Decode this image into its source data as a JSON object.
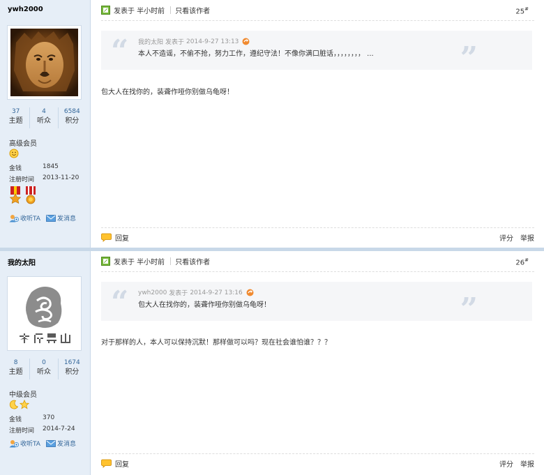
{
  "posts": [
    {
      "author": "ywh2000",
      "stats": [
        {
          "value": "37",
          "label": "主题"
        },
        {
          "value": "4",
          "label": "听众"
        },
        {
          "value": "6584",
          "label": "积分"
        }
      ],
      "rank": "高级会员",
      "info": [
        {
          "label": "金钱",
          "value": "1845"
        },
        {
          "label": "注册时间",
          "value": "2013-11-20"
        }
      ],
      "links": {
        "follow": "收听TA",
        "message": "发消息"
      },
      "header": {
        "posted": "发表于 半小时前",
        "only_author": "只看该作者",
        "floor": "25",
        "floor_mark": "#"
      },
      "quote": {
        "author": "我的太阳",
        "posted_label": "发表于",
        "time": "2014-9-27 13:13",
        "text": "本人不造谣，不偷不抢，努力工作，遵纪守法！不像你满口脏话，，，，，，，，  ..."
      },
      "content": "包大人在找你的，装聋作哑你别做乌龟呀！",
      "footer": {
        "reply": "回复",
        "rate": "评分",
        "report": "举报"
      }
    },
    {
      "author": "我的太阳",
      "avatar_text": "乐居昆山",
      "stats": [
        {
          "value": "8",
          "label": "主题"
        },
        {
          "value": "0",
          "label": "听众"
        },
        {
          "value": "1674",
          "label": "积分"
        }
      ],
      "rank": "中级会员",
      "info": [
        {
          "label": "金钱",
          "value": "370"
        },
        {
          "label": "注册时间",
          "value": "2014-7-24"
        }
      ],
      "links": {
        "follow": "收听TA",
        "message": "发消息"
      },
      "header": {
        "posted": "发表于 半小时前",
        "only_author": "只看该作者",
        "floor": "26",
        "floor_mark": "#"
      },
      "quote": {
        "author": "ywh2000",
        "posted_label": "发表于",
        "time": "2014-9-27 13:16",
        "text": "包大人在找你的，装聋作哑你别做乌龟呀！"
      },
      "content": "对于那样的人，本人可以保持沉默！那样做可以吗？现在社会谁怕谁？？？",
      "footer": {
        "reply": "回复",
        "rate": "评分",
        "report": "举报"
      }
    }
  ],
  "colors": {
    "side_bg": "#e6eef7",
    "link": "#336699",
    "quote_bg": "#f5f6f8",
    "separator": "#c8d8e8"
  },
  "icons": [
    "pen-icon",
    "arrow-link-icon",
    "smiley-icon",
    "moon-icon",
    "star-icon",
    "medal-icon",
    "follow-icon",
    "message-icon",
    "reply-icon"
  ]
}
